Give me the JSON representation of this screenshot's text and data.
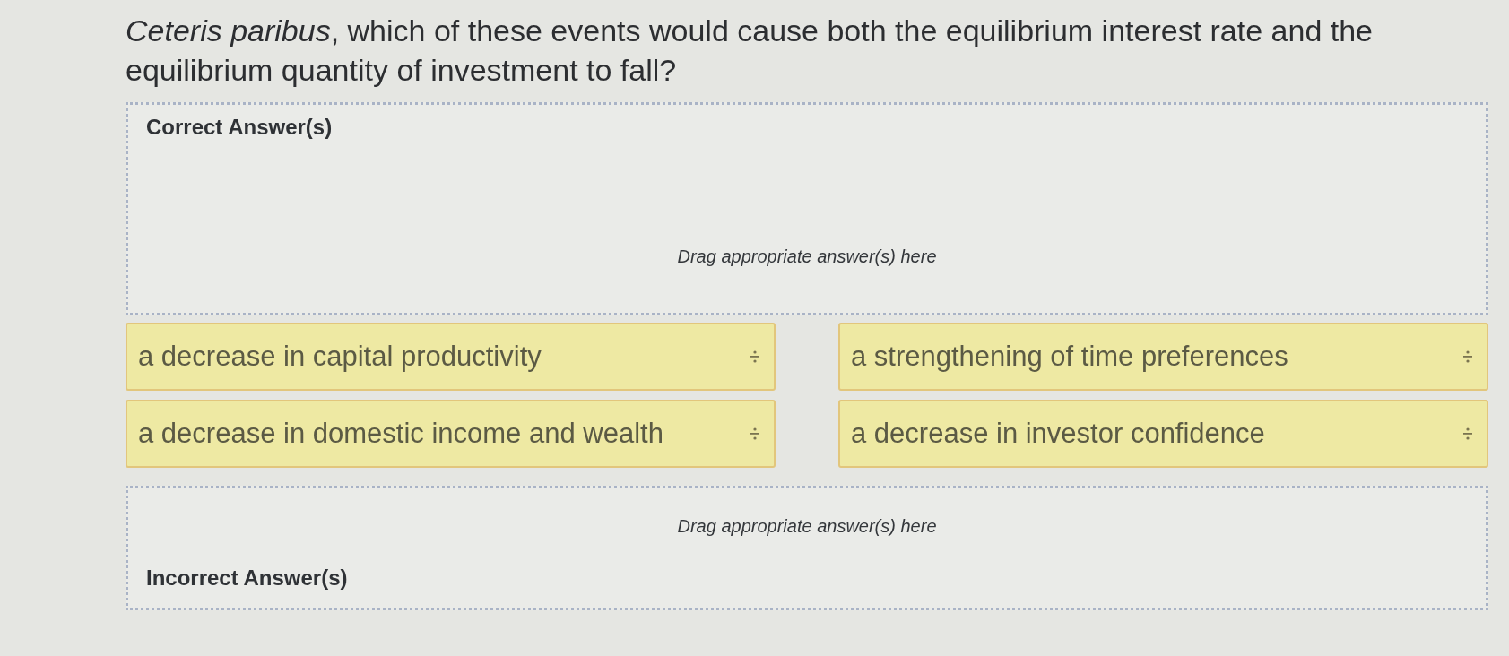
{
  "question": {
    "text": "*Ceteris paribus*, which of these events would cause both the equilibrium interest rate and the equilibrium quantity of investment to fall?"
  },
  "correct_zone": {
    "label": "Correct Answer(s)",
    "hint": "Drag appropriate answer(s) here"
  },
  "choices": [
    {
      "text": "a decrease in capital productivity"
    },
    {
      "text": "a strengthening of time preferences"
    },
    {
      "text": "a decrease in domestic income and wealth"
    },
    {
      "text": "a decrease in investor confidence"
    }
  ],
  "incorrect_zone": {
    "label": "Incorrect Answer(s)",
    "hint": "Drag appropriate answer(s) here"
  }
}
